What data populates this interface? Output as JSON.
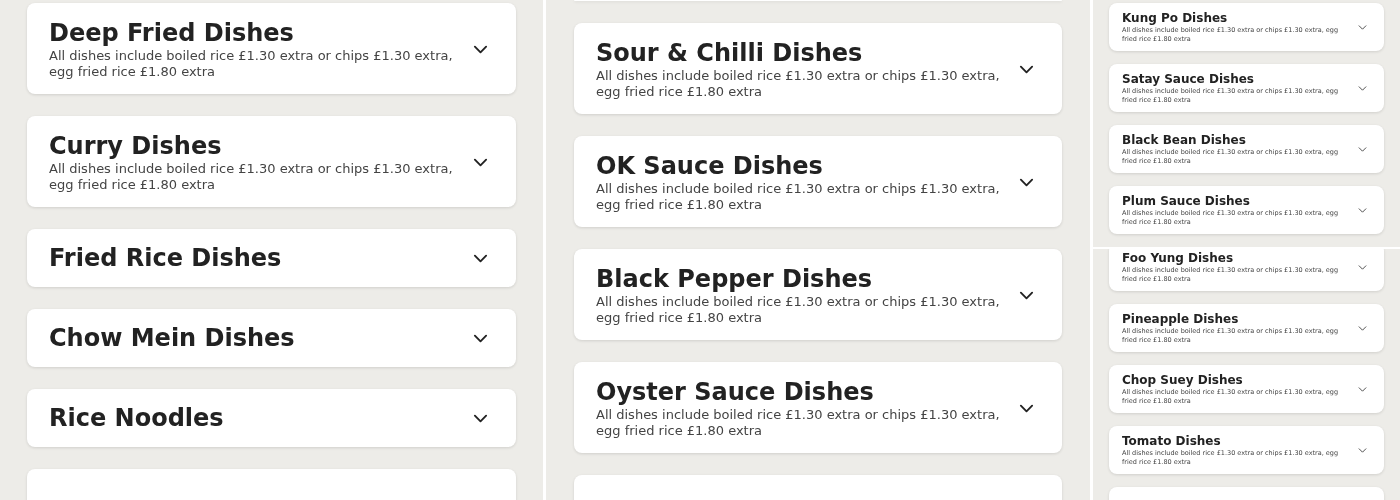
{
  "columns": [
    {
      "segments": [
        {
          "cut_card_above": false,
          "cut_card_below": true,
          "cards": [
            {
              "title": "Deep Fried Dishes",
              "description": "All dishes include boiled rice £1.30 extra or chips £1.30 extra, egg fried rice £1.80 extra",
              "expanded": false
            },
            {
              "title": "Curry Dishes",
              "description": "All dishes include boiled rice £1.30 extra or chips £1.30 extra, egg fried rice £1.80 extra",
              "expanded": false
            },
            {
              "title": "Fried Rice Dishes",
              "expanded": false
            },
            {
              "title": "Chow Mein Dishes",
              "expanded": false
            },
            {
              "title": "Rice Noodles",
              "expanded": false
            }
          ]
        }
      ]
    },
    {
      "segments": [
        {
          "cut_card_above": true,
          "cut_card_below": true,
          "cards": [
            {
              "title": "Sour & Chilli Dishes",
              "description": "All dishes include boiled rice £1.30 extra or chips £1.30 extra, egg fried rice £1.80 extra",
              "expanded": false
            },
            {
              "title": "OK Sauce Dishes",
              "description": "All dishes include boiled rice £1.30 extra or chips £1.30 extra, egg fried rice £1.80 extra",
              "expanded": false
            },
            {
              "title": "Black Pepper Dishes",
              "description": "All dishes include boiled rice £1.30 extra or chips £1.30 extra, egg fried rice £1.80 extra",
              "expanded": false
            },
            {
              "title": "Oyster Sauce Dishes",
              "description": "All dishes include boiled rice £1.30 extra or chips £1.30 extra, egg fried rice £1.80 extra",
              "expanded": false
            }
          ]
        }
      ]
    },
    {
      "segments": [
        {
          "cut_card_above": false,
          "cards": [
            {
              "title": "Kung Po Dishes",
              "description": "All dishes include boiled rice £1.30 extra or chips £1.30 extra, egg fried rice £1.80 extra",
              "expanded": false
            },
            {
              "title": "Satay Sauce Dishes",
              "description": "All dishes include boiled rice £1.30 extra or chips £1.30 extra, egg fried rice £1.80 extra",
              "expanded": false
            },
            {
              "title": "Black Bean Dishes",
              "description": "All dishes include boiled rice £1.30 extra or chips £1.30 extra, egg fried rice £1.80 extra",
              "expanded": false
            },
            {
              "title": "Plum Sauce Dishes",
              "description": "All dishes include boiled rice £1.30 extra or chips £1.30 extra, egg fried rice £1.80 extra",
              "expanded": false
            }
          ]
        },
        {
          "cut_card_above": false,
          "cut_card_below": true,
          "cards": [
            {
              "title": "Foo Yung Dishes",
              "description": "All dishes include boiled rice £1.30 extra or chips £1.30 extra, egg fried rice £1.80 extra",
              "expanded": false
            },
            {
              "title": "Pineapple Dishes",
              "description": "All dishes include boiled rice £1.30 extra or chips £1.30 extra, egg fried rice £1.80 extra",
              "expanded": false
            },
            {
              "title": "Chop Suey Dishes",
              "description": "All dishes include boiled rice £1.30 extra or chips £1.30 extra, egg fried rice £1.80 extra",
              "expanded": false
            },
            {
              "title": "Tomato Dishes",
              "description": "All dishes include boiled rice £1.30 extra or chips £1.30 extra, egg fried rice £1.80 extra",
              "expanded": false
            }
          ]
        }
      ]
    }
  ]
}
